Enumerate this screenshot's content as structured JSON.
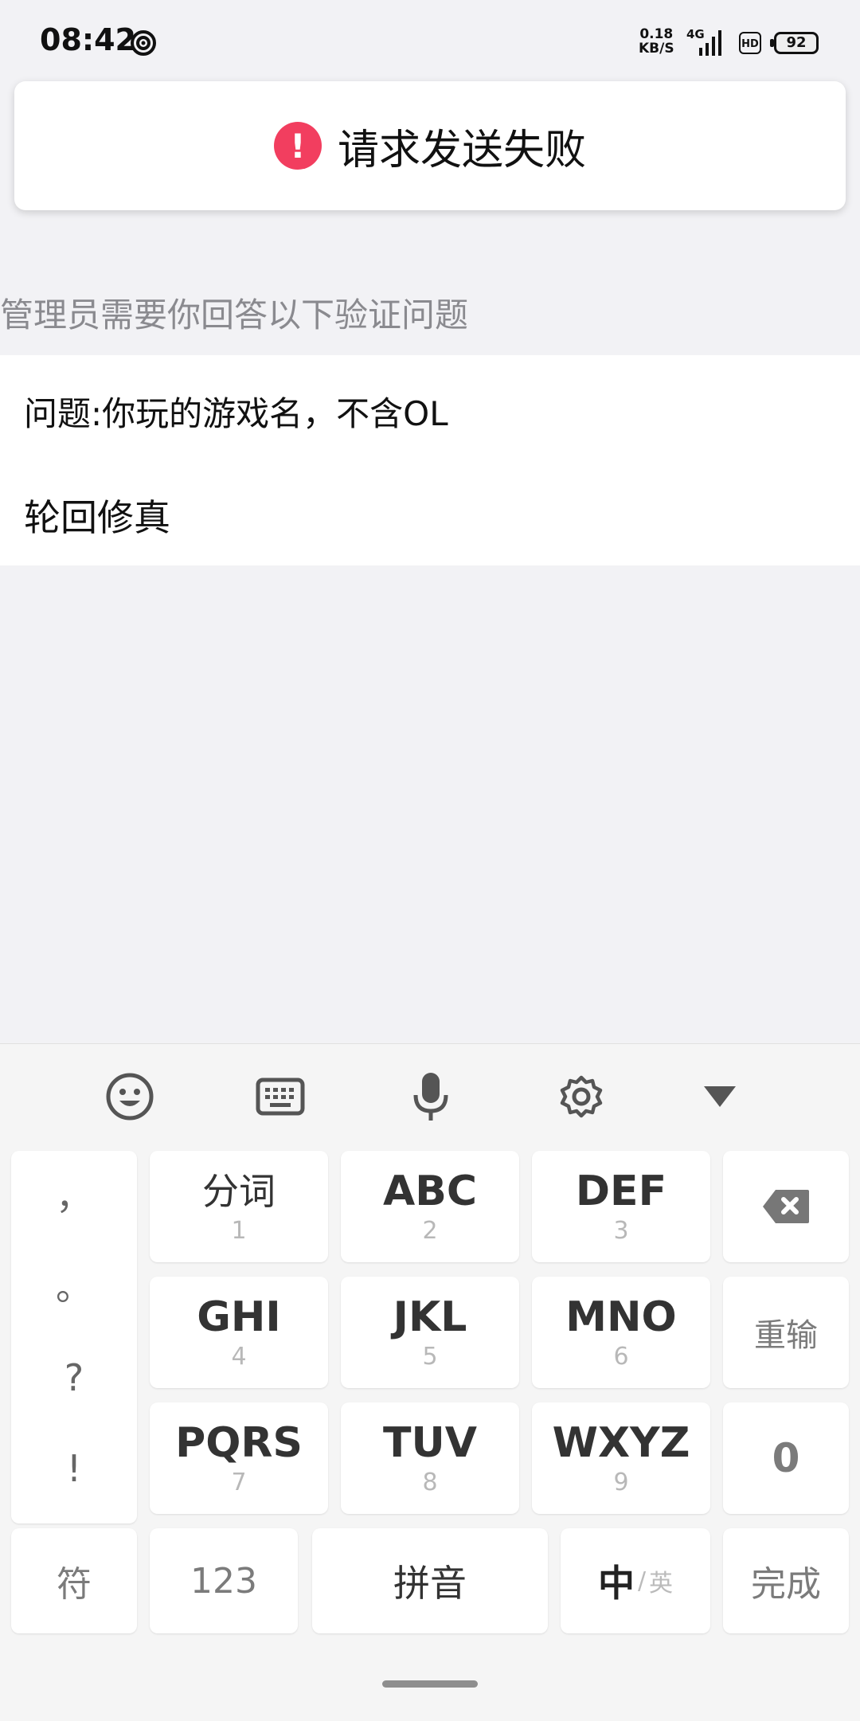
{
  "status_bar": {
    "time": "08:42",
    "speed_value": "0.18",
    "speed_unit": "KB/S",
    "network": "4G",
    "hd": "HD",
    "battery": "92"
  },
  "toast": {
    "text": "请求发送失败",
    "icon": "exclamation-icon",
    "icon_glyph": "!",
    "icon_color": "#f23e5f"
  },
  "hint": "管理员需要你回答以下验证问题",
  "question": "问题:你玩的游戏名，不含OL",
  "answer": "轮回修真",
  "keyboard": {
    "toolbar": [
      "emoji-icon",
      "keyboard-icon",
      "microphone-icon",
      "settings-icon",
      "collapse-icon"
    ],
    "punctuation": [
      "，",
      "。",
      "?",
      "!"
    ],
    "rows": [
      [
        {
          "main": "分词",
          "sub": "1"
        },
        {
          "main": "ABC",
          "sub": "2"
        },
        {
          "main": "DEF",
          "sub": "3"
        }
      ],
      [
        {
          "main": "GHI",
          "sub": "4"
        },
        {
          "main": "JKL",
          "sub": "5"
        },
        {
          "main": "MNO",
          "sub": "6"
        }
      ],
      [
        {
          "main": "PQRS",
          "sub": "7"
        },
        {
          "main": "TUV",
          "sub": "8"
        },
        {
          "main": "WXYZ",
          "sub": "9"
        }
      ]
    ],
    "reinput": "重输",
    "zero": "0",
    "symbol": "符",
    "numbers": "123",
    "pinyin": "拼音",
    "lang_main": "中",
    "lang_sep": "/",
    "lang_alt": "英",
    "done": "完成"
  }
}
